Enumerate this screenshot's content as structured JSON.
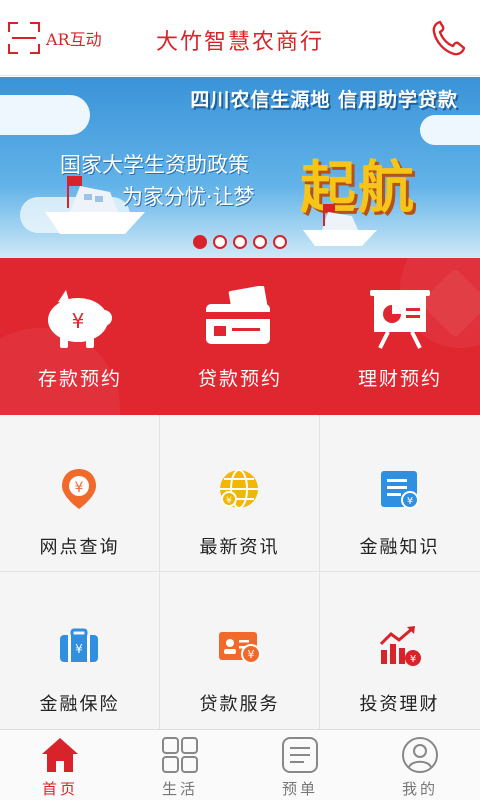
{
  "header": {
    "ar_label": "AR互动",
    "title": "大竹智慧农商行"
  },
  "banner": {
    "headline": "四川农信生源地 信用助学贷款",
    "line1": "国家大学生资助政策",
    "line2": "为家分忧·让梦",
    "big": "起航",
    "slide_count": 5,
    "active_slide": 0
  },
  "appointments": [
    {
      "label": "存款预约",
      "icon": "piggy-bank-icon"
    },
    {
      "label": "贷款预约",
      "icon": "card-money-icon"
    },
    {
      "label": "理财预约",
      "icon": "presentation-board-icon"
    }
  ],
  "services": [
    {
      "label": "网点查询",
      "icon": "location-pin-icon"
    },
    {
      "label": "最新资讯",
      "icon": "globe-coin-icon"
    },
    {
      "label": "金融知识",
      "icon": "document-coin-icon"
    },
    {
      "label": "金融保险",
      "icon": "briefcase-icon"
    },
    {
      "label": "贷款服务",
      "icon": "id-card-coin-icon"
    },
    {
      "label": "投资理财",
      "icon": "growth-chart-icon"
    }
  ],
  "tabs": [
    {
      "label": "首页",
      "icon": "home-icon",
      "active": true
    },
    {
      "label": "生活",
      "icon": "grid-icon",
      "active": false
    },
    {
      "label": "预单",
      "icon": "list-icon",
      "active": false
    },
    {
      "label": "我的",
      "icon": "user-icon",
      "active": false
    }
  ],
  "colors": {
    "brand_red": "#d8232a",
    "band_red": "#e0262f",
    "banner_blue": "#3a93d8",
    "orange": "#f26a2b",
    "yellow": "#f2b705",
    "blue": "#2f8fe0"
  }
}
